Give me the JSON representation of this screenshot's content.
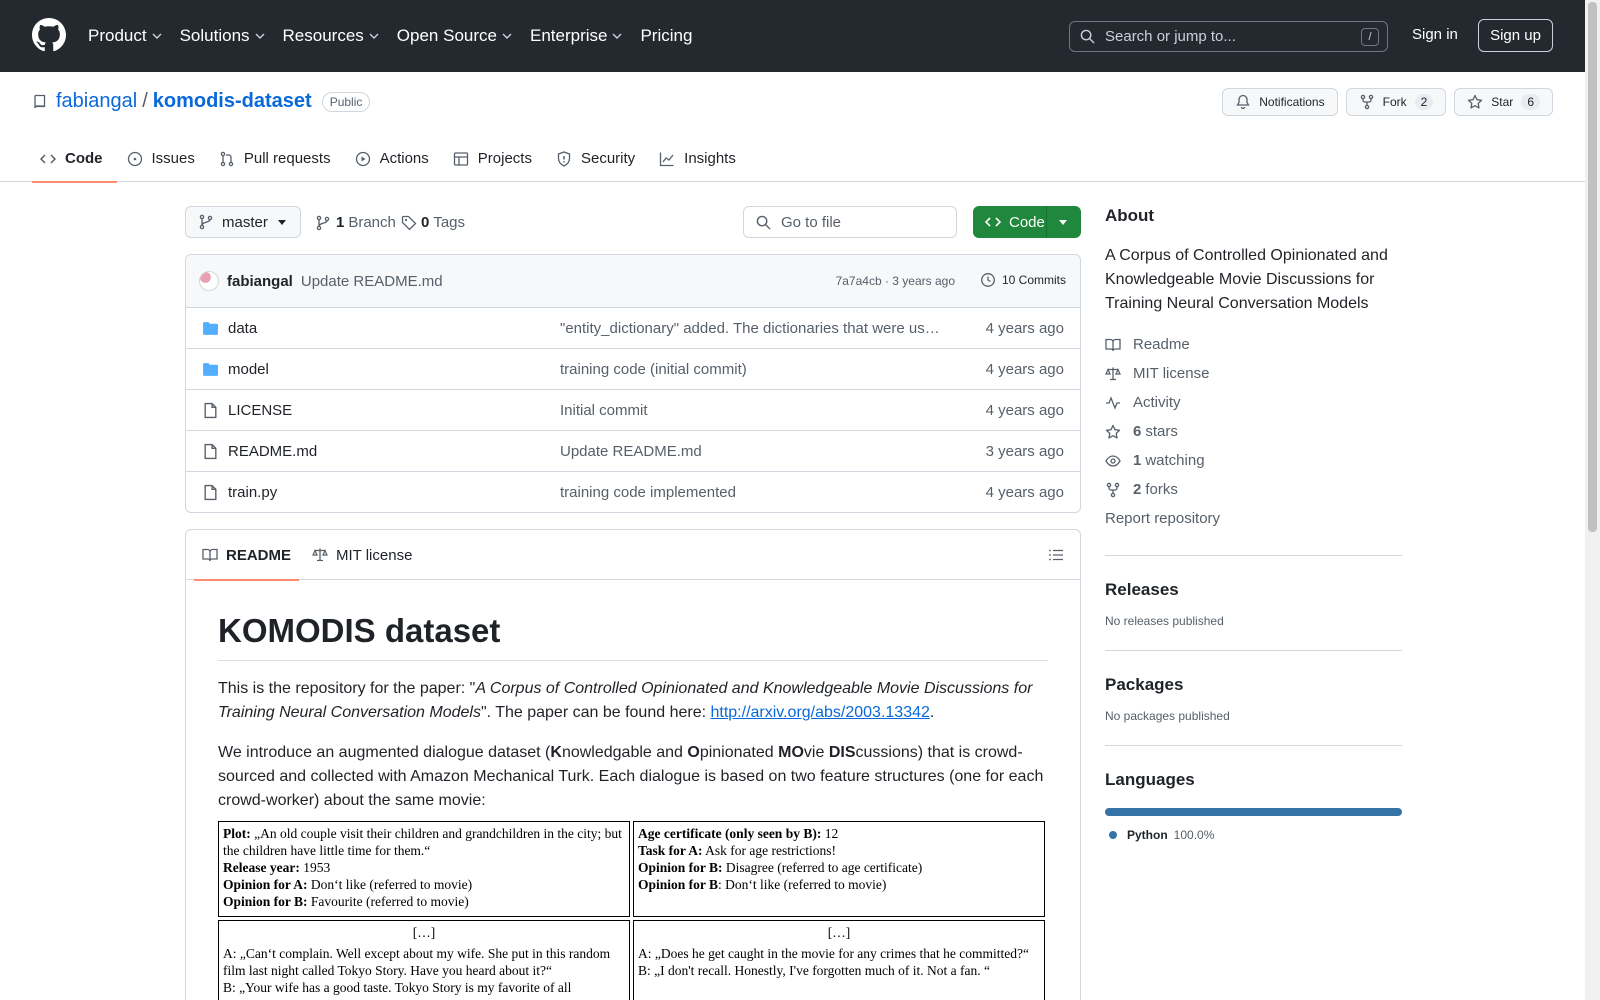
{
  "nav": {
    "items": [
      "Product",
      "Solutions",
      "Resources",
      "Open Source",
      "Enterprise",
      "Pricing"
    ],
    "search_placeholder": "Search or jump to...",
    "search_shortcut": "/",
    "signin": "Sign in",
    "signup": "Sign up"
  },
  "repo": {
    "owner": "fabiangal",
    "separator": "/",
    "name": "komodis-dataset",
    "visibility": "Public",
    "notifications": "Notifications",
    "fork_label": "Fork",
    "fork_count": "2",
    "star_label": "Star",
    "star_count": "6"
  },
  "tabs": [
    "Code",
    "Issues",
    "Pull requests",
    "Actions",
    "Projects",
    "Security",
    "Insights"
  ],
  "toolbar": {
    "branch": "master",
    "branch_count": "1",
    "branch_label": "Branch",
    "tag_count": "0",
    "tag_label": "Tags",
    "goto_placeholder": "Go to file",
    "code_label": "Code"
  },
  "commit": {
    "author": "fabiangal",
    "message": "Update README.md",
    "hash_time": "7a7a4cb · 3 years ago",
    "commits": "10 Commits"
  },
  "files": [
    {
      "name": "data",
      "type": "dir",
      "message": "\"entity_dictionary\" added. The dictionaries that were used t…",
      "date": "4 years ago"
    },
    {
      "name": "model",
      "type": "dir",
      "message": "training code (initial commit)",
      "date": "4 years ago"
    },
    {
      "name": "LICENSE",
      "type": "file",
      "message": "Initial commit",
      "date": "4 years ago"
    },
    {
      "name": "README.md",
      "type": "file",
      "message": "Update README.md",
      "date": "3 years ago"
    },
    {
      "name": "train.py",
      "type": "file",
      "message": "training code implemented",
      "date": "4 years ago"
    }
  ],
  "readme": {
    "tab_readme": "README",
    "tab_license": "MIT license",
    "title": "KOMODIS dataset",
    "p1_pre": "This is the repository for the paper: \"",
    "p1_italic": "A Corpus of Controlled Opinionated and Knowledgeable Movie Discussions for Training Neural Conversation Models",
    "p1_mid": "\". The paper can be found here: ",
    "p1_link": "http://arxiv.org/abs/2003.13342",
    "p1_end": ".",
    "p2_a": "We introduce an augmented dialogue dataset (",
    "p2_K": "K",
    "p2_b": "nowledgable and ",
    "p2_O": "O",
    "p2_c": "pinionated ",
    "p2_MO": "MO",
    "p2_d": "vie ",
    "p2_DIS": "DIS",
    "p2_e": "cussions) that is crowd-sourced and collected with Amazon Mechanical Turk. Each dialogue is based on two feature structures (one for each crowd-worker) about the same movie:",
    "table": {
      "c1": [
        {
          "b": "Plot:",
          "t": " „An old couple visit their children and grandchildren in the city; but the children  have  little time for them.“"
        },
        {
          "b": "Release year:",
          "t": " 1953"
        },
        {
          "b": "Opinion for A:",
          "t": " Don‘t like (referred to movie)"
        },
        {
          "b": "Opinion for B:",
          "t": " Favourite (referred to movie)"
        }
      ],
      "c2": [
        {
          "b": "Age certificate (only seen by B):",
          "t": " 12"
        },
        {
          "b": "Task for A:",
          "t": " Ask for age restrictions!"
        },
        {
          "b": "Opinion for B:",
          "t": " Disagree (referred to age certificate)"
        },
        {
          "b": "Opinion for B",
          "t": ": Don‘t like (referred to movie)"
        }
      ],
      "c3_head": "[…]",
      "c3_lines": [
        "A: „Can‘t complain. Well except about my wife. She put in this random film last night called Tokyo Story. Have you heard about it?“",
        "B: „Your wife has a good taste. Tokyo Story is my favorite of all"
      ],
      "c4_head": "[…]",
      "c4_lines": [
        "A: „Does he get caught in the movie for any crimes that he committed?“",
        "B: „I don't recall. Honestly, I've forgotten much of it. Not a fan. “"
      ]
    }
  },
  "about": {
    "heading": "About",
    "description": "A Corpus of Controlled Opinionated and Knowledgeable Movie Discussions for Training Neural Conversation Models",
    "readme": "Readme",
    "license": "MIT license",
    "activity": "Activity",
    "stars_count": "6",
    "stars_label": "stars",
    "watching_count": "1",
    "watching_label": "watching",
    "forks_count": "2",
    "forks_label": "forks",
    "report": "Report repository"
  },
  "releases": {
    "heading": "Releases",
    "text": "No releases published"
  },
  "packages": {
    "heading": "Packages",
    "text": "No packages published"
  },
  "languages": {
    "heading": "Languages",
    "items": [
      {
        "name": "Python",
        "percent": "100.0%",
        "color": "#3572A5",
        "fraction": 1.0
      }
    ]
  },
  "colors": {
    "accent": "#0969da",
    "green": "#1f883d",
    "tab_underline": "#fd8c73",
    "dark_header": "#24292f"
  }
}
